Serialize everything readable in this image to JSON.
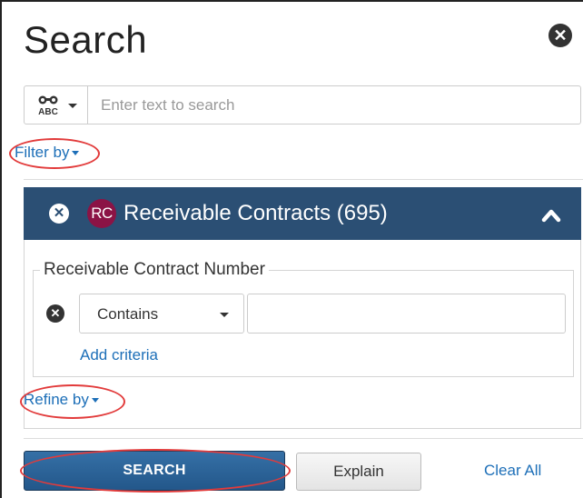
{
  "header": {
    "title": "Search"
  },
  "search": {
    "placeholder": "Enter text to search",
    "value": ""
  },
  "filter": {
    "label": "Filter by"
  },
  "panel": {
    "badge": "RC",
    "title": "Receivable Contracts (695)",
    "badge_color": "#8b1345",
    "header_color": "#2b4f74"
  },
  "criteria": {
    "legend": "Receivable Contract Number",
    "operator": "Contains",
    "value": "",
    "add_label": "Add criteria"
  },
  "refine": {
    "label": "Refine by"
  },
  "actions": {
    "search_label": "SEARCH",
    "explain_label": "Explain",
    "clear_label": "Clear All"
  },
  "annotation_color": "#e23b3b"
}
